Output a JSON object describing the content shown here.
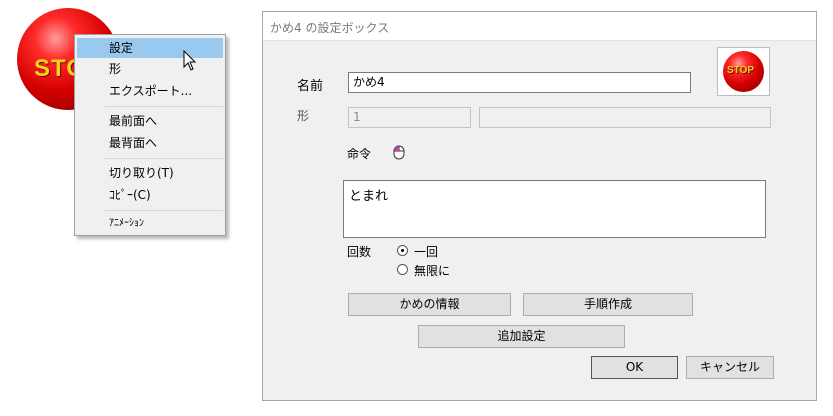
{
  "canvas": {
    "ball_text": "STO"
  },
  "context_menu": {
    "items": [
      {
        "label": "設定"
      },
      {
        "label": "形"
      },
      {
        "label": "エクスポート..."
      },
      {
        "label": "最前面へ"
      },
      {
        "label": "最背面へ"
      },
      {
        "label": "切り取り(T)"
      },
      {
        "label": "ｺﾋﾟｰ(C)"
      },
      {
        "label": "ｱﾆﾒｰｼｮﾝ"
      }
    ]
  },
  "dialog": {
    "title": "かめ4 の設定ボックス",
    "name_label": "名前",
    "name_value": "かめ4",
    "shape_label": "形",
    "shape_value": "1",
    "shape_desc": "",
    "icon_text": "STOP",
    "command_label": "命令",
    "command_text": "とまれ",
    "count_label": "回数",
    "radio_once": "一回",
    "radio_infinite": "無限に",
    "btn_info": "かめの情報",
    "btn_procedure": "手順作成",
    "btn_additional": "追加設定",
    "btn_ok": "OK",
    "btn_cancel": "キャンセル"
  },
  "colors": {
    "menu_highlight": "#99c9ef",
    "dialog_bg": "#f0f0f0",
    "stop_red": "#d40000",
    "stop_text": "#f2d21a"
  }
}
